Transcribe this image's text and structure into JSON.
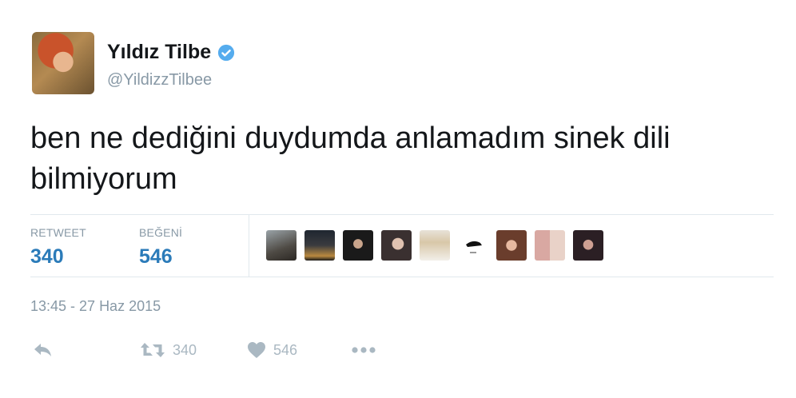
{
  "user": {
    "display_name": "Yıldız Tilbe",
    "handle": "@YildizzTilbee",
    "verified": true
  },
  "tweet": {
    "text": "ben ne dediğini duydumda anlamadım sinek dili bilmiyorum",
    "timestamp": "13:45 - 27 Haz 2015"
  },
  "stats": {
    "retweet_label": "RETWEET",
    "retweet_count": "340",
    "like_label": "BEĞENİ",
    "like_count": "546"
  },
  "actions": {
    "retweet_count": "340",
    "like_count": "546"
  },
  "colors": {
    "accent_blue": "#2b7bb9",
    "muted_gray": "#8899a6",
    "icon_gray": "#aab8c2",
    "verified_blue": "#55acee"
  }
}
